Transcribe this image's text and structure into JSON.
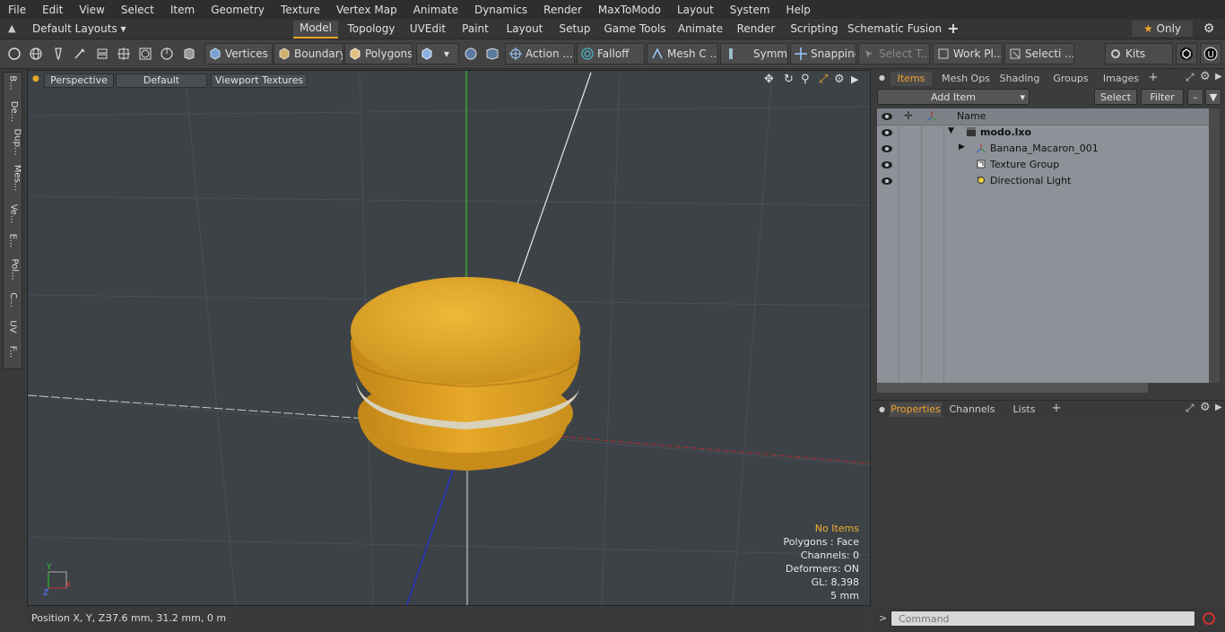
{
  "menu": [
    "File",
    "Edit",
    "View",
    "Select",
    "Item",
    "Geometry",
    "Texture",
    "Vertex Map",
    "Animate",
    "Dynamics",
    "Render",
    "MaxToModo",
    "Layout",
    "System",
    "Help"
  ],
  "layout_bar": {
    "layouts_label": "Default Layouts",
    "tabs": [
      "Model",
      "Topology",
      "UVEdit",
      "Paint",
      "Layout",
      "Setup",
      "Game Tools",
      "Animate",
      "Render",
      "Scripting",
      "Schematic Fusion"
    ],
    "active_tab": "Model",
    "add_symbol": "+",
    "only_label": "Only"
  },
  "toolbar": {
    "vertices": "Vertices",
    "boundary": "Boundary",
    "polygons": "Polygons",
    "action": "Action ...",
    "falloff": "Falloff",
    "mesh": "Mesh C ...",
    "symm": "Symm ...",
    "snapping": "Snapping",
    "select_t": "Select T...",
    "work_pl": "Work Pl...",
    "selecti": "Selecti ...",
    "kits": "Kits"
  },
  "left_tabs": [
    "B...",
    "De...",
    "Dup...",
    "Mes...",
    "Ve...",
    "E...",
    "Pol...",
    "C...",
    "UV",
    "F..."
  ],
  "viewport": {
    "view_label": "Perspective",
    "shading_label": "Default",
    "textures_label": "Viewport Textures",
    "info": {
      "selection": "No Items",
      "polygons": "Polygons : Face",
      "channels": "Channels: 0",
      "deformers": "Deformers: ON",
      "gl": "GL: 8,398",
      "scale": "5 mm"
    },
    "axis_labels": {
      "y": "Y",
      "x": "X",
      "z": "Z"
    }
  },
  "status": {
    "position_label": "Position X, Y, Z:",
    "position_value": "37.6 mm, 31.2 mm, 0 m"
  },
  "items_panel": {
    "tabs": [
      "Items",
      "Mesh Ops",
      "Shading",
      "Groups",
      "Images"
    ],
    "active_tab": "Items",
    "add_item": "Add Item",
    "select": "Select",
    "filter": "Filter",
    "name_header": "Name",
    "tree": [
      {
        "label": "modo.lxo",
        "bold": true
      },
      {
        "label": "Banana_Macaron_001",
        "bold": false
      },
      {
        "label": "Texture Group",
        "bold": false
      },
      {
        "label": "Directional Light",
        "bold": false
      }
    ]
  },
  "properties_panel": {
    "tabs": [
      "Properties",
      "Channels",
      "Lists"
    ],
    "active_tab": "Properties"
  },
  "command": {
    "placeholder": "Command",
    "prompt": ">"
  },
  "colors": {
    "accent": "#e8a628",
    "macaron": "#e8a826",
    "macaron_shadow": "#b8801a",
    "filling": "#d8d4c0",
    "viewport_bg": "#3d4247"
  }
}
